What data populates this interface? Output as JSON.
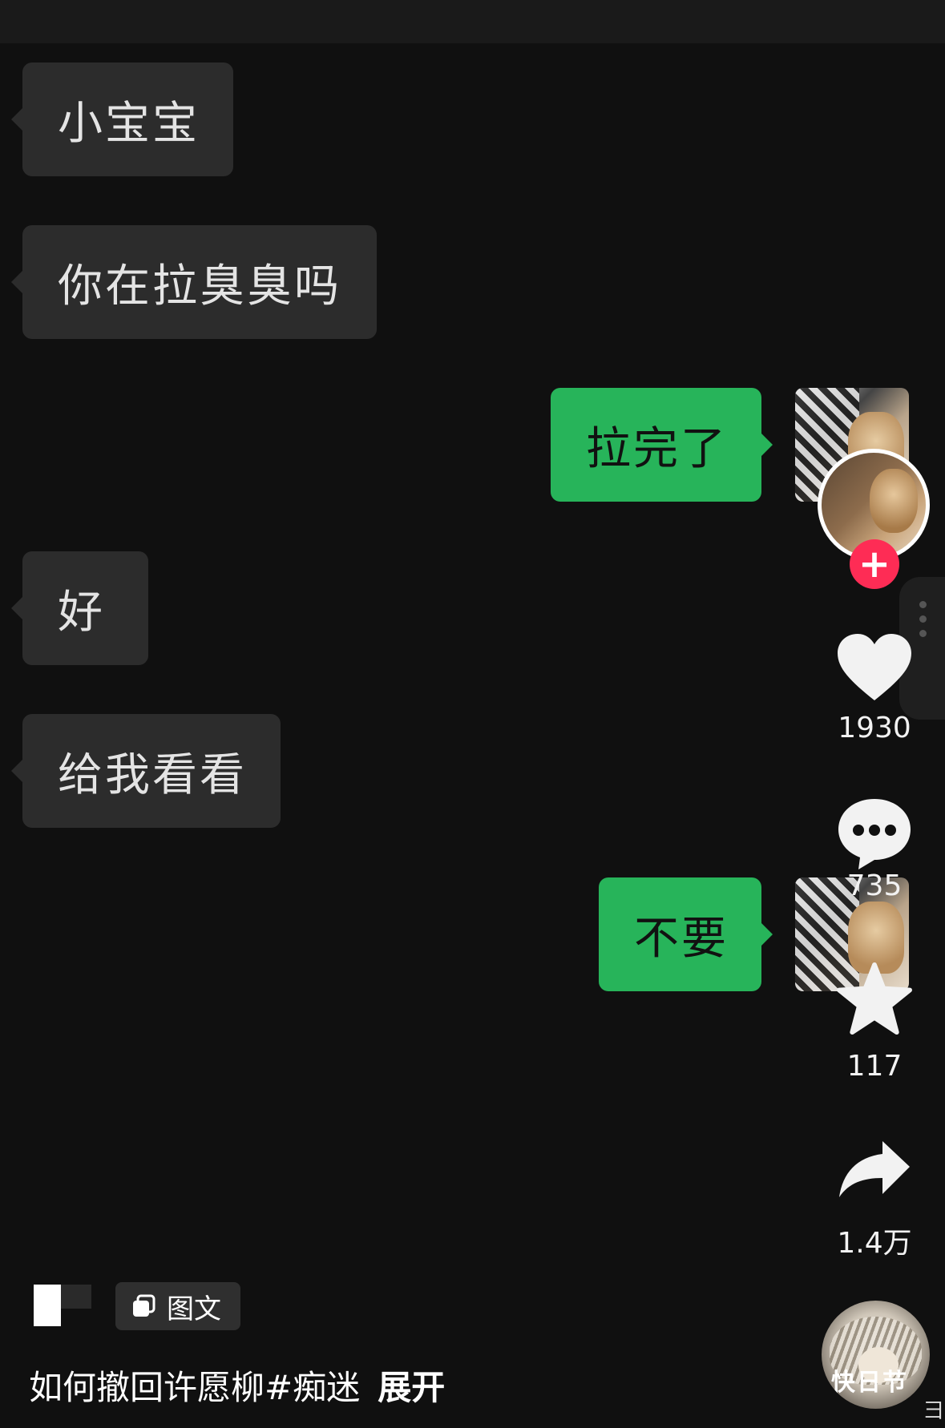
{
  "chat": {
    "messages": [
      {
        "side": "left",
        "text": "小宝宝"
      },
      {
        "side": "left",
        "text": "你在拉臭臭吗"
      },
      {
        "side": "right",
        "text": "拉完了"
      },
      {
        "side": "left",
        "text": "好"
      },
      {
        "side": "left",
        "text": "给我看看"
      },
      {
        "side": "right",
        "text": "不要"
      }
    ]
  },
  "creator": {
    "follow_symbol": "+"
  },
  "actions": {
    "likes": "1930",
    "comments": "735",
    "favorites": "117",
    "shares": "1.4万"
  },
  "post": {
    "type_label": "图文",
    "caption": "如何撤回许愿柳#痴迷",
    "expand_label": "展开"
  },
  "music": {
    "disc_text": "快日节"
  },
  "edge": {
    "glyph": "彐"
  },
  "colors": {
    "background": "#101010",
    "incoming_bubble": "#2c2c2c",
    "outgoing_bubble": "#27b45a",
    "follow_button": "#fe2c55"
  },
  "icons": [
    "plus-icon",
    "heart-icon",
    "comment-icon",
    "star-icon",
    "share-icon",
    "image-text-icon",
    "more-dots-icon"
  ]
}
